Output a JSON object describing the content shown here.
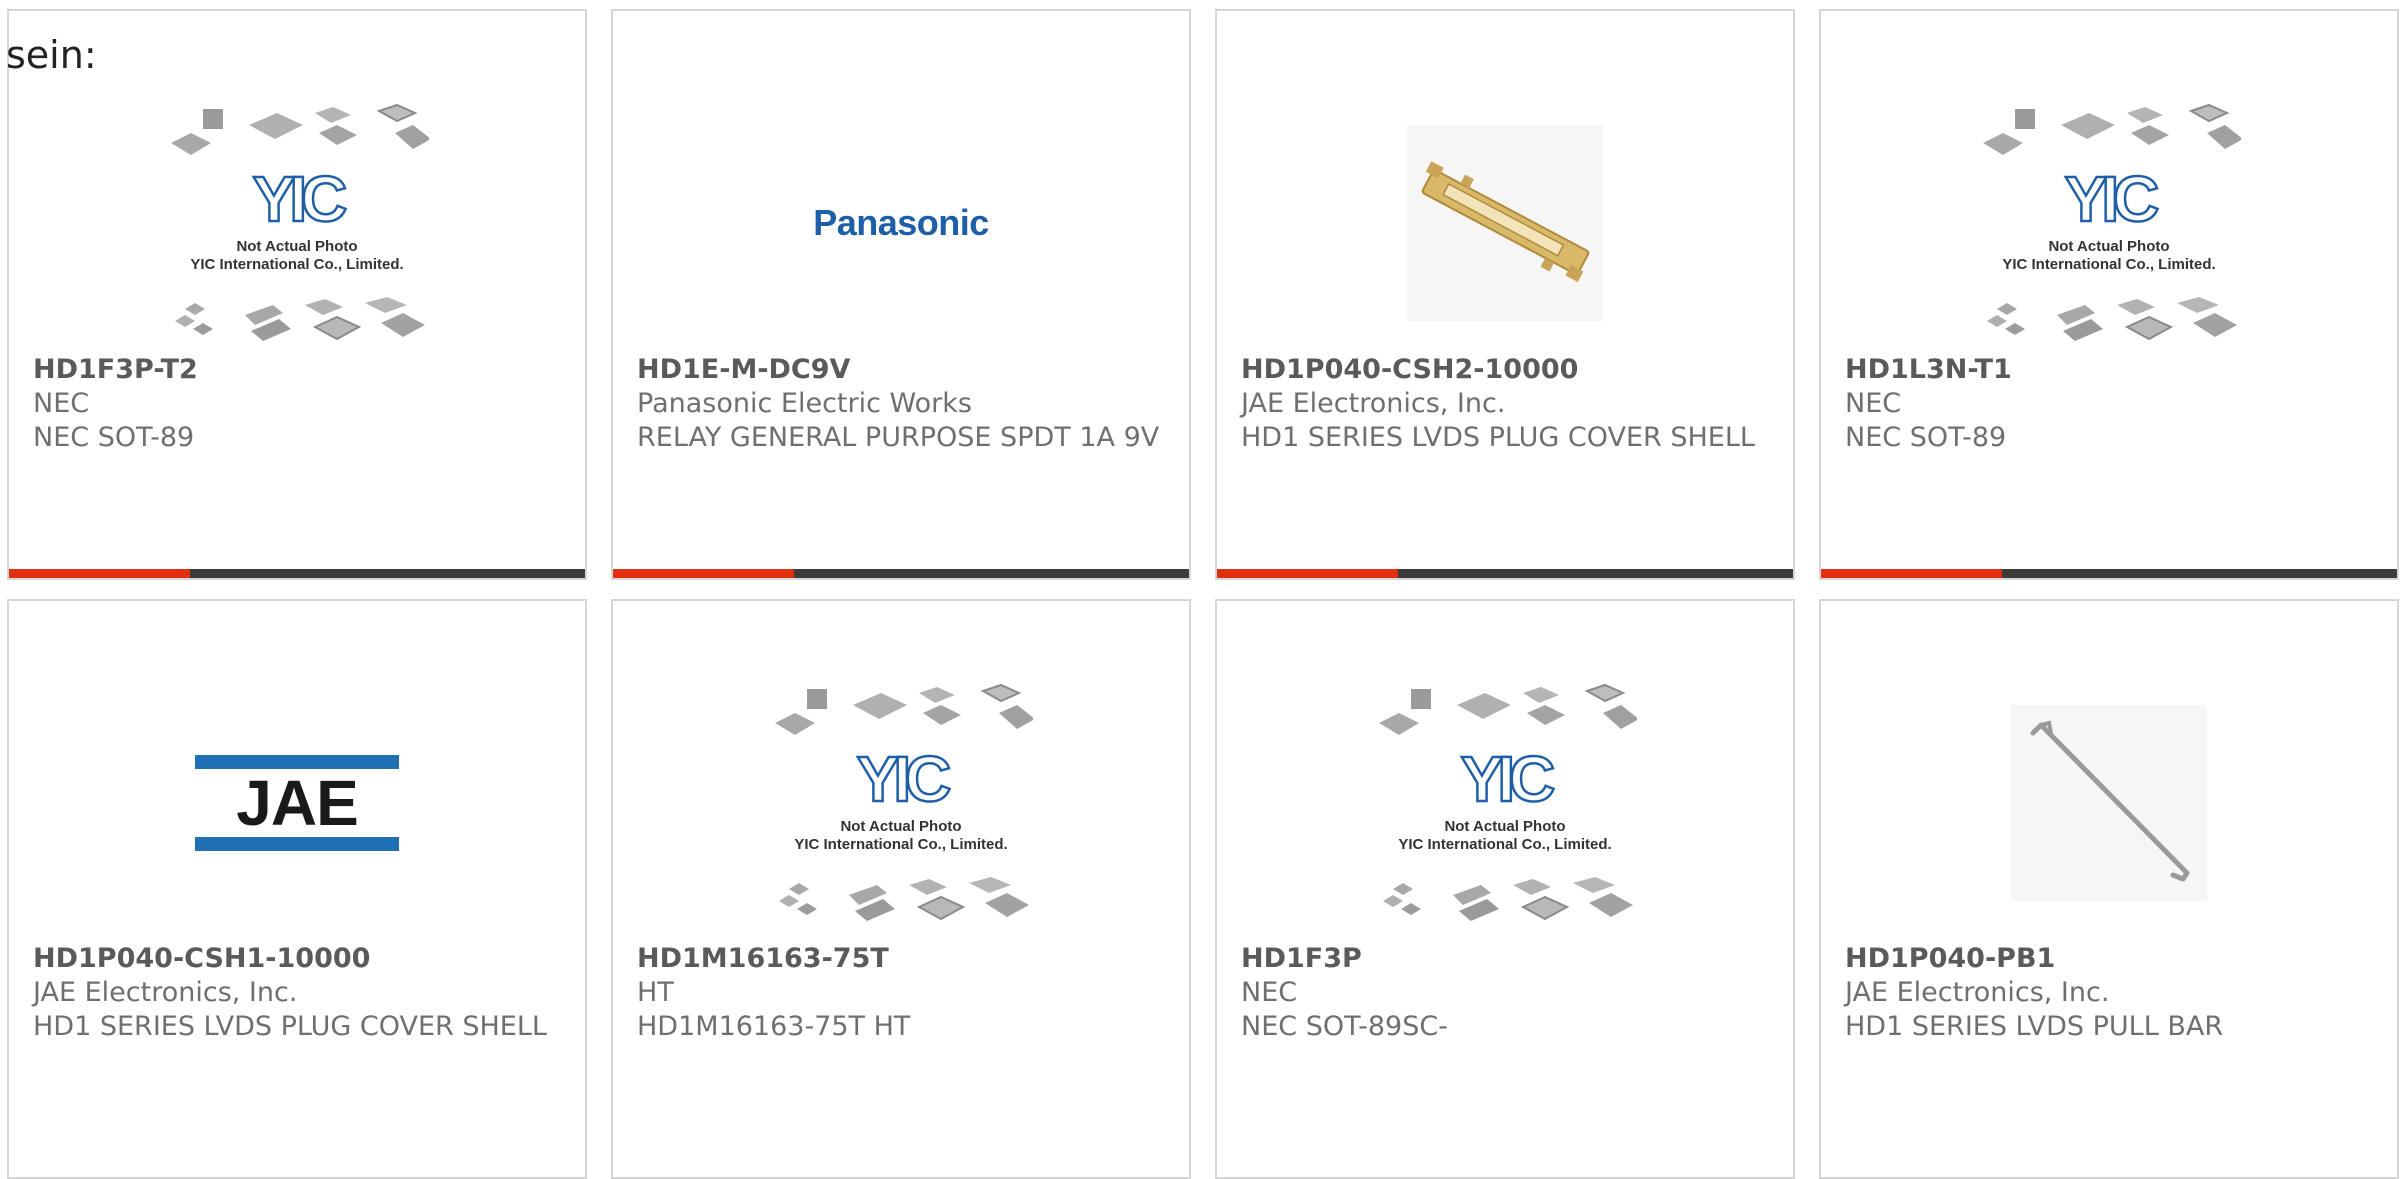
{
  "intro_text": "sein:",
  "placeholder": {
    "caption_line1": "Not Actual Photo",
    "caption_line2": "YIC International Co., Limited."
  },
  "brands": {
    "panasonic": "Panasonic"
  },
  "colors": {
    "accent": "#e0300f",
    "bar_dark": "#3b3b3b",
    "card_border": "#d6d6d6",
    "text_gray": "#6f6f6f",
    "yic_blue": "#1f5fa8",
    "panasonic_blue": "#1c5ea8",
    "jae_blue": "#1f6fb4"
  },
  "products": [
    {
      "part": "HD1F3P-T2",
      "maker": "NEC",
      "desc": "NEC SOT-89",
      "image": "yic-placeholder-icon"
    },
    {
      "part": "HD1E-M-DC9V",
      "maker": "Panasonic Electric Works",
      "desc": "RELAY GENERAL PURPOSE SPDT 1A 9V",
      "image": "panasonic-logo"
    },
    {
      "part": "HD1P040-CSH2-10000",
      "maker": "JAE Electronics, Inc.",
      "desc": "HD1 SERIES LVDS PLUG COVER SHELL",
      "image": "cover-shell-photo"
    },
    {
      "part": "HD1L3N-T1",
      "maker": "NEC",
      "desc": "NEC SOT-89",
      "image": "yic-placeholder-icon"
    },
    {
      "part": "HD1P040-CSH1-10000",
      "maker": "JAE Electronics, Inc.",
      "desc": "HD1 SERIES LVDS PLUG COVER SHELL",
      "image": "jae-logo"
    },
    {
      "part": "HD1M16163-75T",
      "maker": "HT",
      "desc": "HD1M16163-75T HT",
      "image": "yic-placeholder-icon"
    },
    {
      "part": "HD1F3P",
      "maker": "NEC",
      "desc": "NEC SOT-89SC-",
      "image": "yic-placeholder-icon"
    },
    {
      "part": "HD1P040-PB1",
      "maker": "JAE Electronics, Inc.",
      "desc": "HD1 SERIES LVDS PULL BAR",
      "image": "pull-bar-photo"
    }
  ]
}
